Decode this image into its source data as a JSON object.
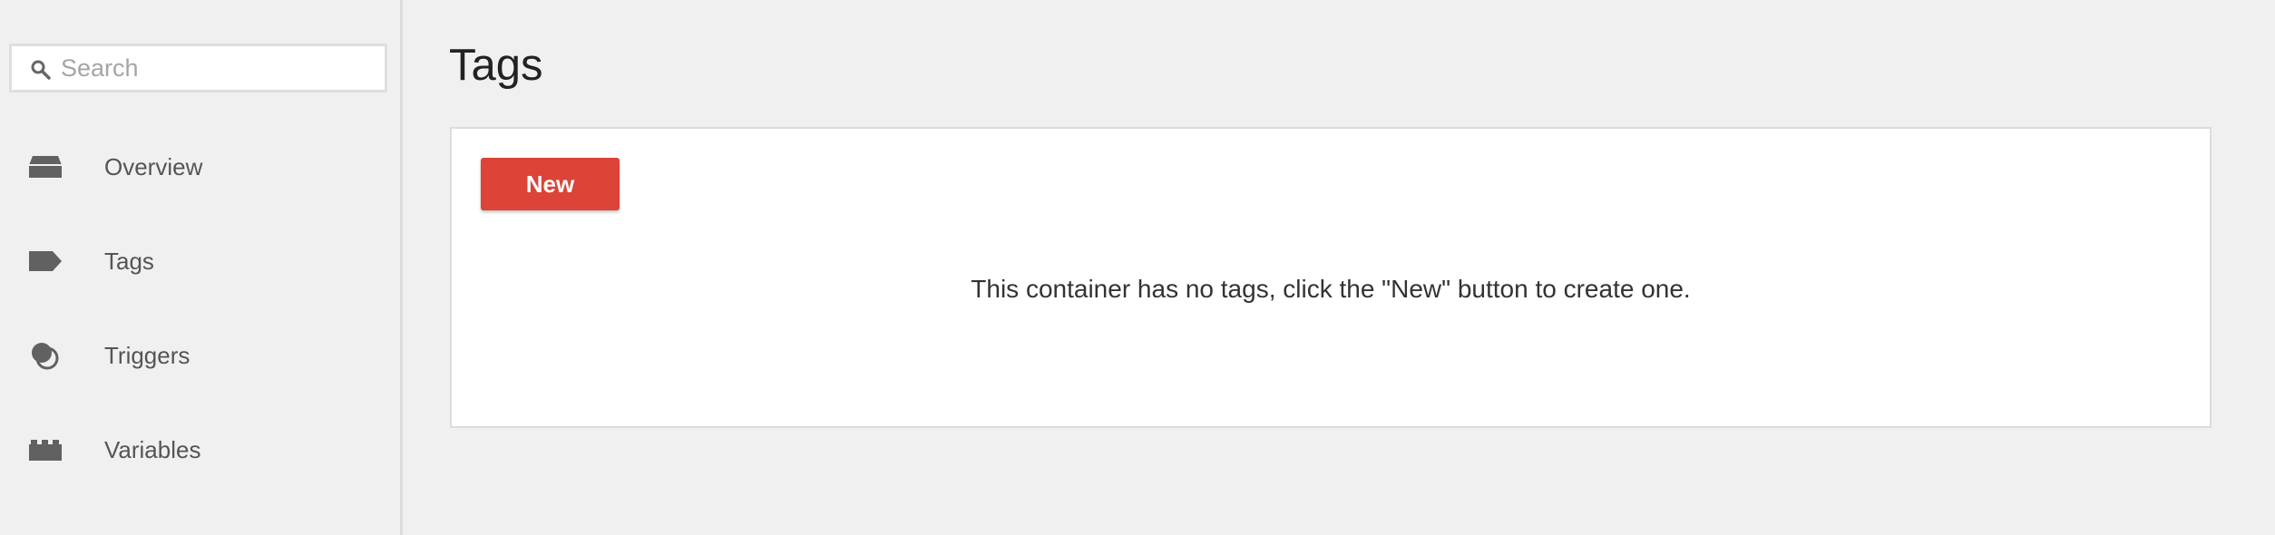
{
  "search": {
    "placeholder": "Search",
    "icon": "search-icon"
  },
  "sidebar": {
    "items": [
      {
        "label": "Overview",
        "icon": "inbox-icon"
      },
      {
        "label": "Tags",
        "icon": "tag-icon"
      },
      {
        "label": "Triggers",
        "icon": "triggers-icon"
      },
      {
        "label": "Variables",
        "icon": "variables-icon"
      }
    ]
  },
  "main": {
    "title": "Tags",
    "new_button_label": "New",
    "empty_message": "This container has no tags, click the \"New\" button to create one."
  },
  "colors": {
    "accent": "#db4437",
    "background": "#f0f0f0",
    "icon": "#616161"
  }
}
